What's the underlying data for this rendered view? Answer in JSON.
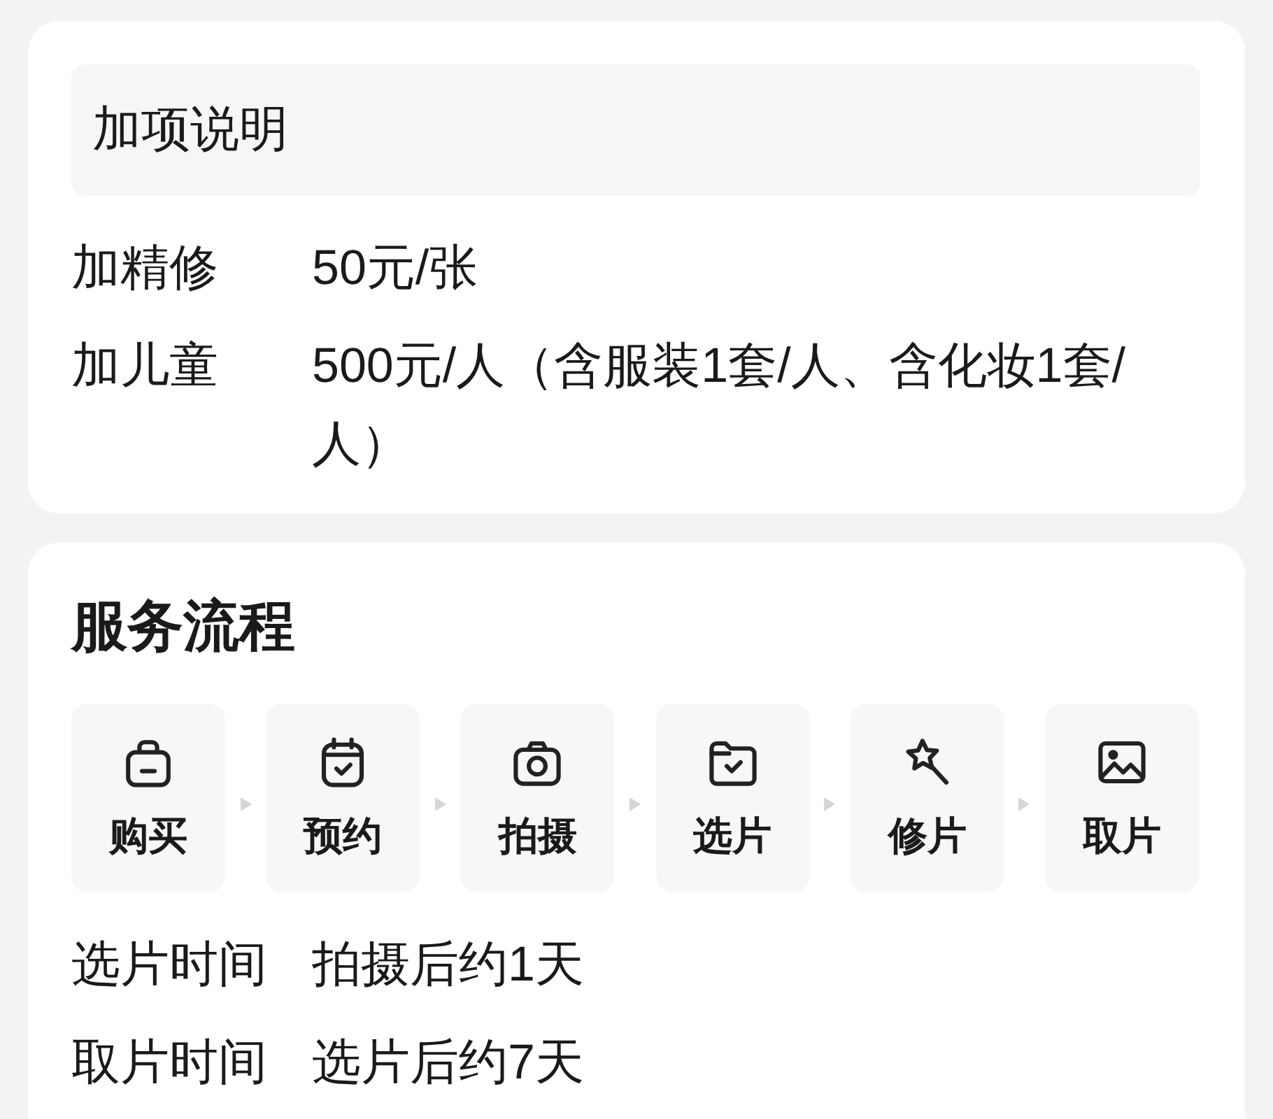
{
  "addon_section": {
    "title": "加项说明",
    "items": [
      {
        "label": "加精修",
        "value": "50元/张"
      },
      {
        "label": "加儿童",
        "value": "500元/人（含服装1套/人、含化妆1套/人）"
      }
    ]
  },
  "service_flow": {
    "title": "服务流程",
    "steps": [
      {
        "label": "购买"
      },
      {
        "label": "预约"
      },
      {
        "label": "拍摄"
      },
      {
        "label": "选片"
      },
      {
        "label": "修片"
      },
      {
        "label": "取片"
      }
    ],
    "details": [
      {
        "label": "选片时间",
        "value": "拍摄后约1天"
      },
      {
        "label": "取片时间",
        "value": "选片后约7天"
      }
    ]
  }
}
